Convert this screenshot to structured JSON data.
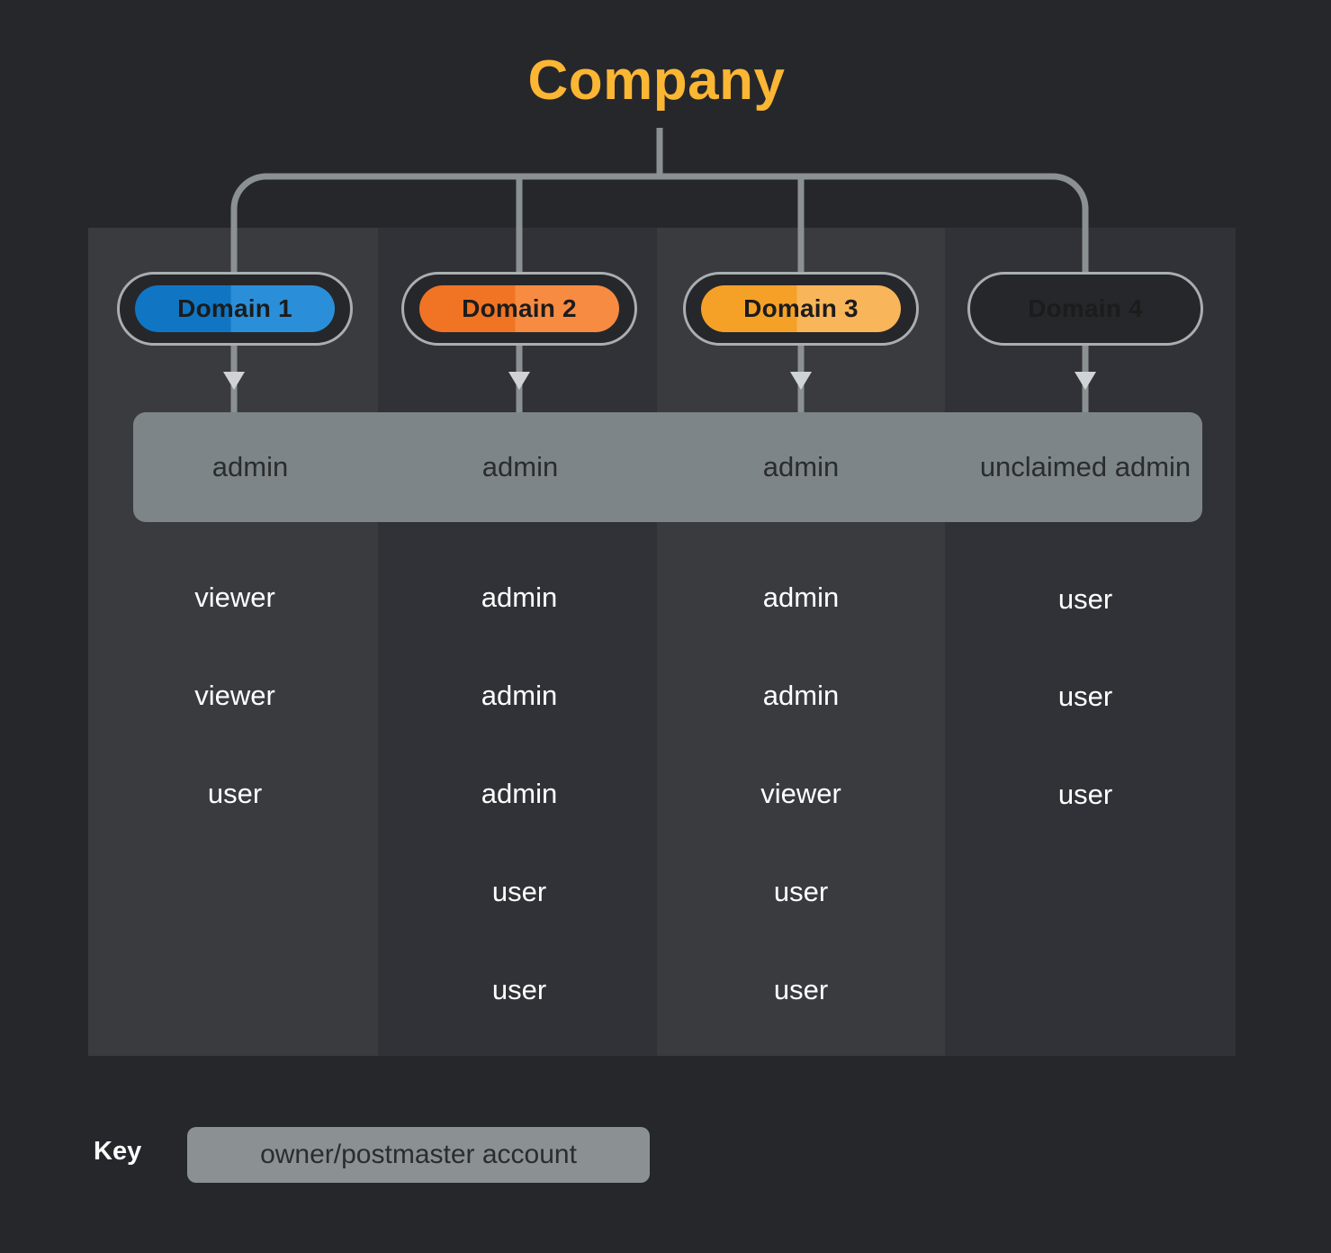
{
  "title": "Company",
  "colors": {
    "background": "#26272b",
    "title": "#fbb633",
    "wire": "#8b9093",
    "owner_bar": "#7e8588",
    "key_box": "#8b9093",
    "column_light": "#3a3b3f",
    "column_dark": "#313237",
    "member_text": "#ffffff",
    "owner_text": "#2a2c2d"
  },
  "columns": [
    {
      "domain": "Domain 1",
      "badge_color_left": "#1076c4",
      "badge_color_right": "#2a8fd8",
      "panel_shade": "light",
      "owner": "admin",
      "members": [
        "viewer",
        "viewer",
        "user"
      ]
    },
    {
      "domain": "Domain 2",
      "badge_color_left": "#f07424",
      "badge_color_right": "#f78b42",
      "panel_shade": "dark",
      "owner": "admin",
      "members": [
        "admin",
        "admin",
        "admin",
        "user",
        "user"
      ]
    },
    {
      "domain": "Domain 3",
      "badge_color_left": "#f5a127",
      "badge_color_right": "#f9b559",
      "panel_shade": "light",
      "owner": "admin",
      "members": [
        "admin",
        "admin",
        "viewer",
        "user",
        "user"
      ]
    },
    {
      "domain": "Domain 4",
      "badge_color_left": "#fbc557",
      "badge_color_right": "#fdd храм",
      "panel_shade": "dark",
      "owner": "unclaimed admin",
      "members": [
        "user",
        "user",
        "user"
      ]
    }
  ],
  "key": {
    "label": "Key",
    "swatch_text": "owner/postmaster account"
  }
}
